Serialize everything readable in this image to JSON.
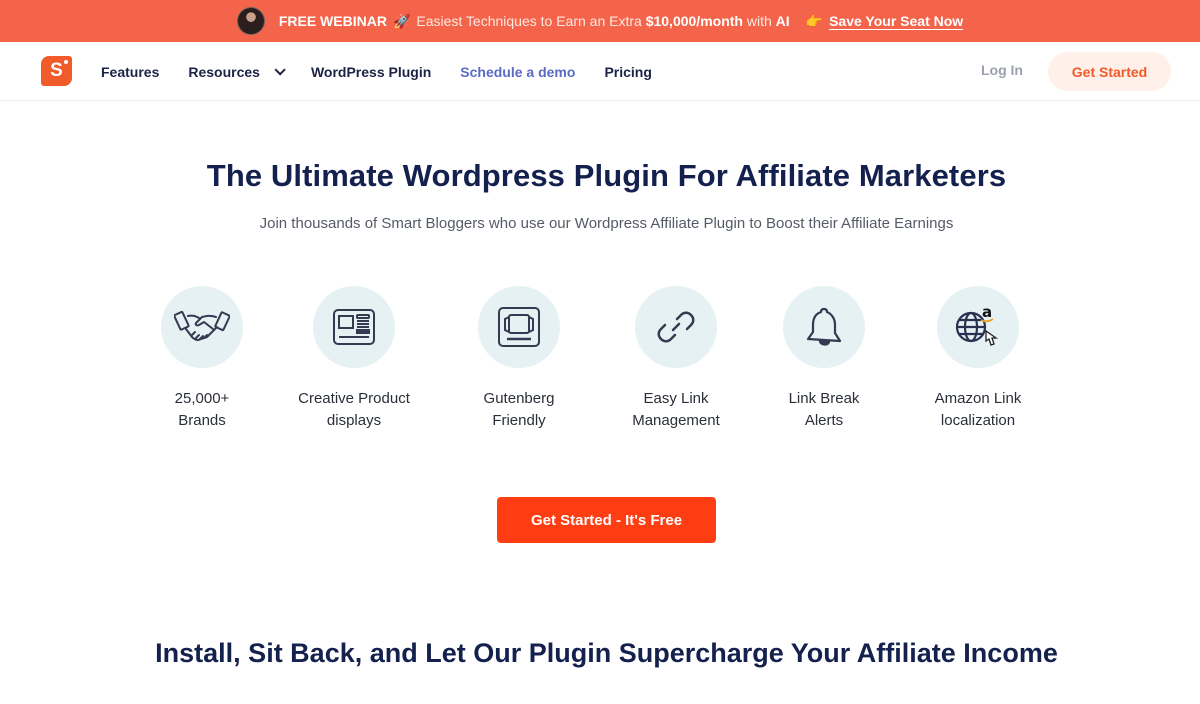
{
  "promo": {
    "label": "FREE WEBINAR",
    "rocket_icon": "🚀",
    "text_prefix": "Easiest Techniques to Earn an Extra",
    "amount": "$10,000/month",
    "text_mid": "with",
    "text_ai": "AI",
    "hand_icon": "👉",
    "link": "Save Your Seat Now",
    "bg_color": "#f4644a"
  },
  "nav": {
    "logo_letter": "S",
    "links": [
      {
        "label": "Features"
      },
      {
        "label": "Resources",
        "has_dropdown": true
      },
      {
        "label": "WordPress Plugin"
      },
      {
        "label": "Schedule a demo"
      },
      {
        "label": "Pricing"
      }
    ],
    "login": "Log In",
    "get_started": "Get Started"
  },
  "hero": {
    "title": "The Ultimate Wordpress Plugin For Affiliate Marketers",
    "subtitle": "Join thousands of Smart Bloggers who use our Wordpress Affiliate Plugin to Boost their Affiliate Earnings",
    "features": [
      {
        "icon": "handshake-icon",
        "line1": "25,000+",
        "line2": "Brands"
      },
      {
        "icon": "product-display-icon",
        "line1": "Creative Product",
        "line2": "displays"
      },
      {
        "icon": "gutenberg-icon",
        "line1": "Gutenberg",
        "line2": "Friendly"
      },
      {
        "icon": "link-icon",
        "line1": "Easy Link",
        "line2": "Management"
      },
      {
        "icon": "bell-icon",
        "line1": "Link Break",
        "line2": "Alerts"
      },
      {
        "icon": "amazon-globe-icon",
        "line1": "Amazon Link",
        "line2": "localization"
      }
    ],
    "cta": "Get Started - It's Free"
  },
  "section": {
    "title": "Install, Sit Back, and Let Our Plugin Supercharge Your Affiliate Income"
  },
  "colors": {
    "brand": "#f15a29",
    "cta": "#ff3d13",
    "navy": "#14204d",
    "demo_link": "#5b6ac4",
    "icon_bg": "#e6f1f3"
  }
}
